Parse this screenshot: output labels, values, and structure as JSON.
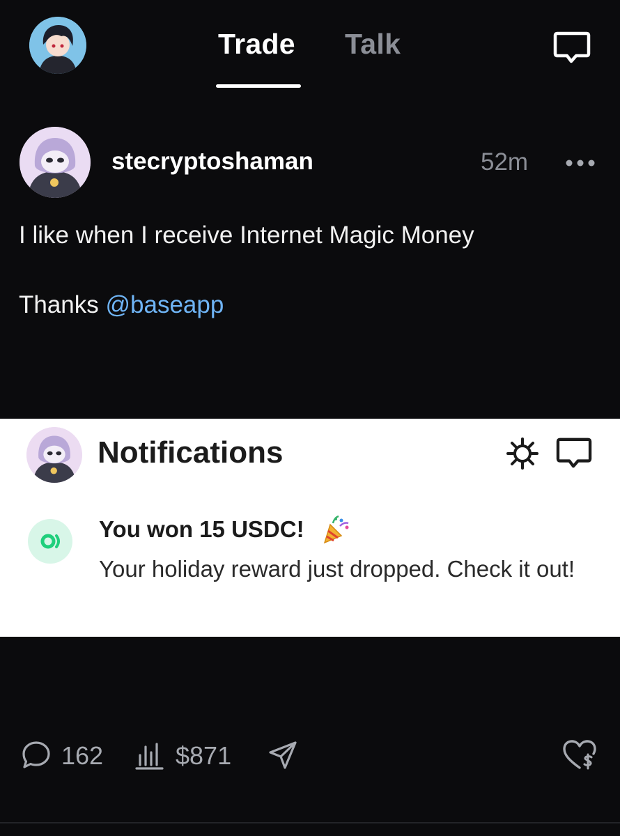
{
  "header": {
    "tabs": [
      {
        "label": "Trade",
        "active": true
      },
      {
        "label": "Talk",
        "active": false
      }
    ],
    "icons": {
      "avatar": "user-avatar",
      "chat": "chat-bubble-icon"
    }
  },
  "post": {
    "username": "stecryptoshaman",
    "time_ago": "52m",
    "line1": "I like when I receive Internet Magic Money",
    "line2_prefix": "Thanks ",
    "mention": "@baseapp",
    "more_icon": "more-horizontal-icon"
  },
  "notification_card": {
    "title": "Notifications",
    "icons": [
      "gear-icon",
      "chat-bubble-icon"
    ],
    "item": {
      "title": "You won 15 USDC!",
      "emoji": "party-popper",
      "body": "Your holiday reward just dropped. Check it out!",
      "icon": "coin-icon"
    }
  },
  "actions": {
    "replies": "162",
    "price": "$871",
    "icons": [
      "reply-icon",
      "stats-icon",
      "share-icon",
      "tip-heart-icon"
    ]
  },
  "colors": {
    "background": "#0b0b0d",
    "muted": "#8b8e96",
    "mention": "#6fb4f5",
    "coin_green": "#1fcf7c"
  }
}
